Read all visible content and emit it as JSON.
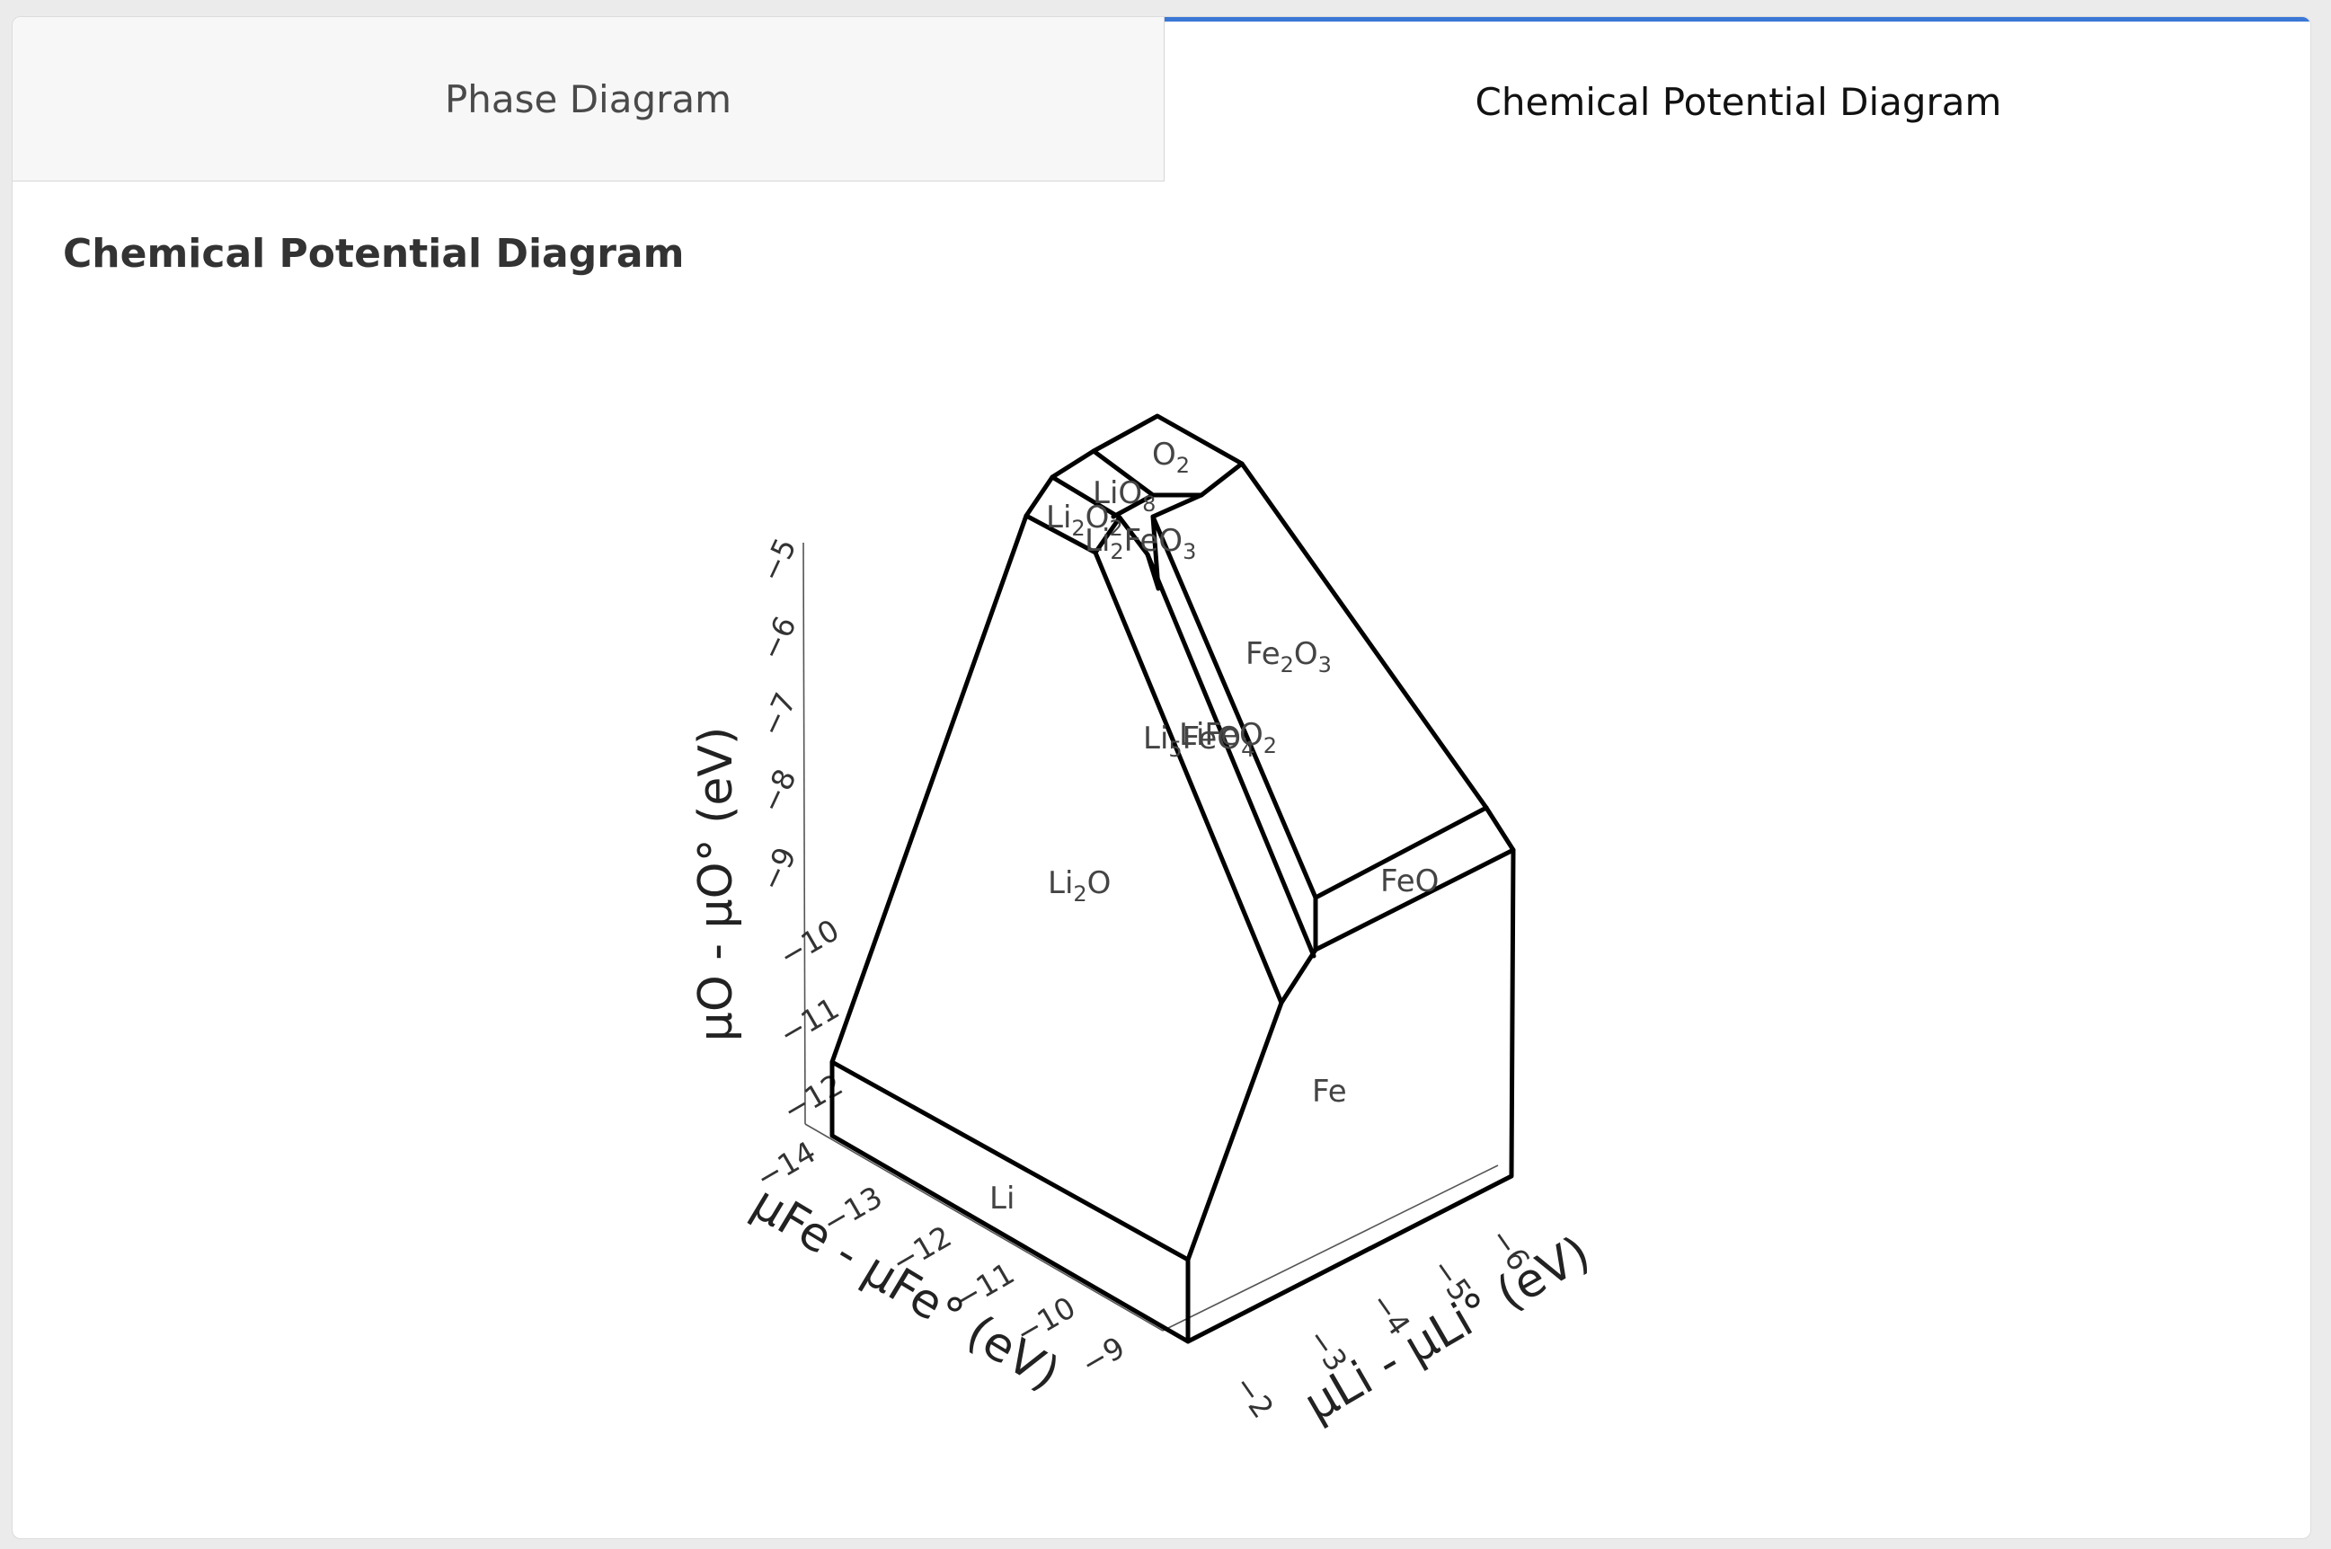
{
  "tabs": {
    "phase_diagram": "Phase Diagram",
    "chemical_potential_diagram": "Chemical Potential Diagram"
  },
  "section_title": "Chemical Potential Diagram",
  "colors": {
    "tab_accent": "#3a77d6",
    "edge": "#000000"
  },
  "axes": {
    "z_title": "μO - μO° (eV)",
    "y_title": "μFe - μFe° (eV)",
    "x_title": "μLi - μLi° (eV)",
    "z_ticks": [
      "−5",
      "−6",
      "−7",
      "−8",
      "−9",
      "−10",
      "−11",
      "−12"
    ],
    "y_ticks": [
      "−14",
      "−13",
      "−12",
      "−11",
      "−10",
      "−9"
    ],
    "x_ticks": [
      "−2",
      "−3",
      "−4",
      "−5",
      "−6"
    ]
  },
  "regions": [
    "O2",
    "LiO8",
    "Li2O2",
    "Li2FeO3",
    "Fe2O3",
    "Li5FeO4",
    "LiFeO2",
    "Li2O",
    "FeO",
    "Fe",
    "Li"
  ]
}
